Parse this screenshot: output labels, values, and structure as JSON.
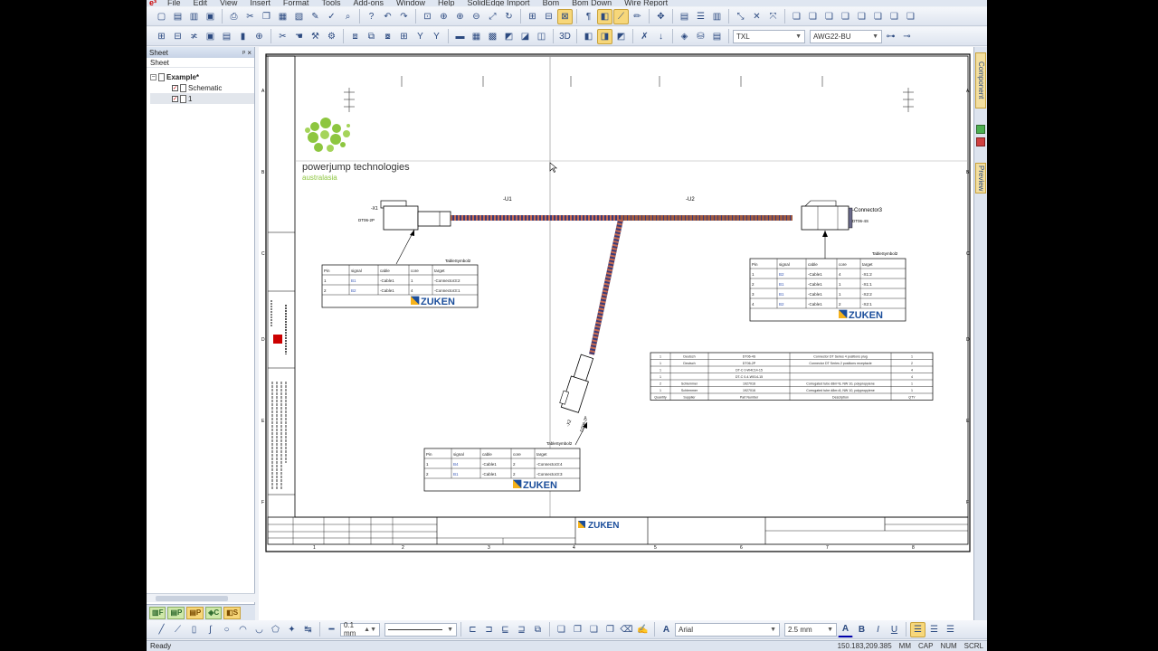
{
  "menu": [
    "File",
    "Edit",
    "View",
    "Insert",
    "Format",
    "Tools",
    "Add-ons",
    "Window",
    "Help",
    "SolidEdge Import",
    "Bom",
    "Bom Down",
    "Wire Report"
  ],
  "toolbar": {
    "wire_type": "TXL",
    "wire_gauge": "AWG22-BU",
    "line_width": "0.1 mm",
    "font_name": "Arial",
    "font_size": "2.5 mm",
    "view_3d": "3D"
  },
  "sheet_panel": {
    "title": "Sheet",
    "column": "Sheet",
    "project": "Example*",
    "children": [
      "Schematic",
      "1"
    ]
  },
  "panel_tabs": [
    "F",
    "P",
    "P",
    "C",
    "S"
  ],
  "right_tabs": [
    "Component",
    "Preview"
  ],
  "drawing": {
    "company": "powerjump technologies",
    "company_sub": "australasia",
    "zuken": "ZUKEN",
    "u1": "-U1",
    "u2": "-U2",
    "x1": "-X1",
    "x1_part": "DT06-2P",
    "x2": "-X2",
    "x2_part": "DT06-2P",
    "connector3": "-Connector3",
    "connector3_part": "DT06-4S",
    "table_label_left": "TableSymbol2",
    "table_label_right": "TableSymbol2",
    "table_label_bottom": "TableSymbol2",
    "pin_headers": [
      "Pin",
      "signal",
      "cable",
      "core",
      "target"
    ],
    "table_left": [
      [
        "1",
        "B1",
        "-Cable1",
        "1",
        "-Connector3:2"
      ],
      [
        "2",
        "B2",
        "-Cable1",
        "4",
        "-Connector3:1"
      ]
    ],
    "table_right": [
      [
        "1",
        "B2",
        "-Cable1",
        "4",
        "-X1:2"
      ],
      [
        "2",
        "B1",
        "-Cable1",
        "1",
        "-X1:1"
      ],
      [
        "3",
        "B1",
        "-Cable1",
        "1",
        "-X2:2"
      ],
      [
        "4",
        "B2",
        "-Cable1",
        "2",
        "-X2:1"
      ]
    ],
    "table_bottom": [
      [
        "1",
        "B4",
        "-Cable1",
        "2",
        "-Connector3:4"
      ],
      [
        "2",
        "B1",
        "-Cable1",
        "2",
        "-Connector3:3"
      ]
    ],
    "bom_rows": [
      [
        "1",
        "Deutsch",
        "DT06-4S",
        "Connector DT Series 4 positions plug",
        "1"
      ],
      [
        "1",
        "Deutsch",
        "DT06-2P",
        "Connector DT Series 2 positions receptacle",
        "2"
      ],
      [
        "1",
        "",
        "DT-C 0-W4C14-15",
        "",
        "4"
      ],
      [
        "1",
        "",
        "DT-C 0-4-W014-15",
        "",
        "4"
      ],
      [
        "2",
        "Schlemmer",
        "1927016",
        "Corrugated tube d8m=8, NW 10, polypropylene",
        "1"
      ],
      [
        "1",
        "Schlemmer",
        "1927016",
        "Corrugated tube d8m=8, NW 10, polypropylene",
        "1"
      ]
    ],
    "bom_footer": [
      "Quantity",
      "Supplier",
      "Part Number",
      "Description",
      "QTY"
    ],
    "row_letters": [
      "A",
      "B",
      "C",
      "D",
      "E",
      "F"
    ],
    "col_numbers": [
      "1",
      "2",
      "3",
      "4",
      "5",
      "6",
      "7",
      "8"
    ]
  },
  "status": {
    "text": "Ready",
    "coords": "150.183,209.385",
    "units": "MM",
    "caps": "CAP",
    "num": "NUM",
    "scrl": "SCRL"
  }
}
